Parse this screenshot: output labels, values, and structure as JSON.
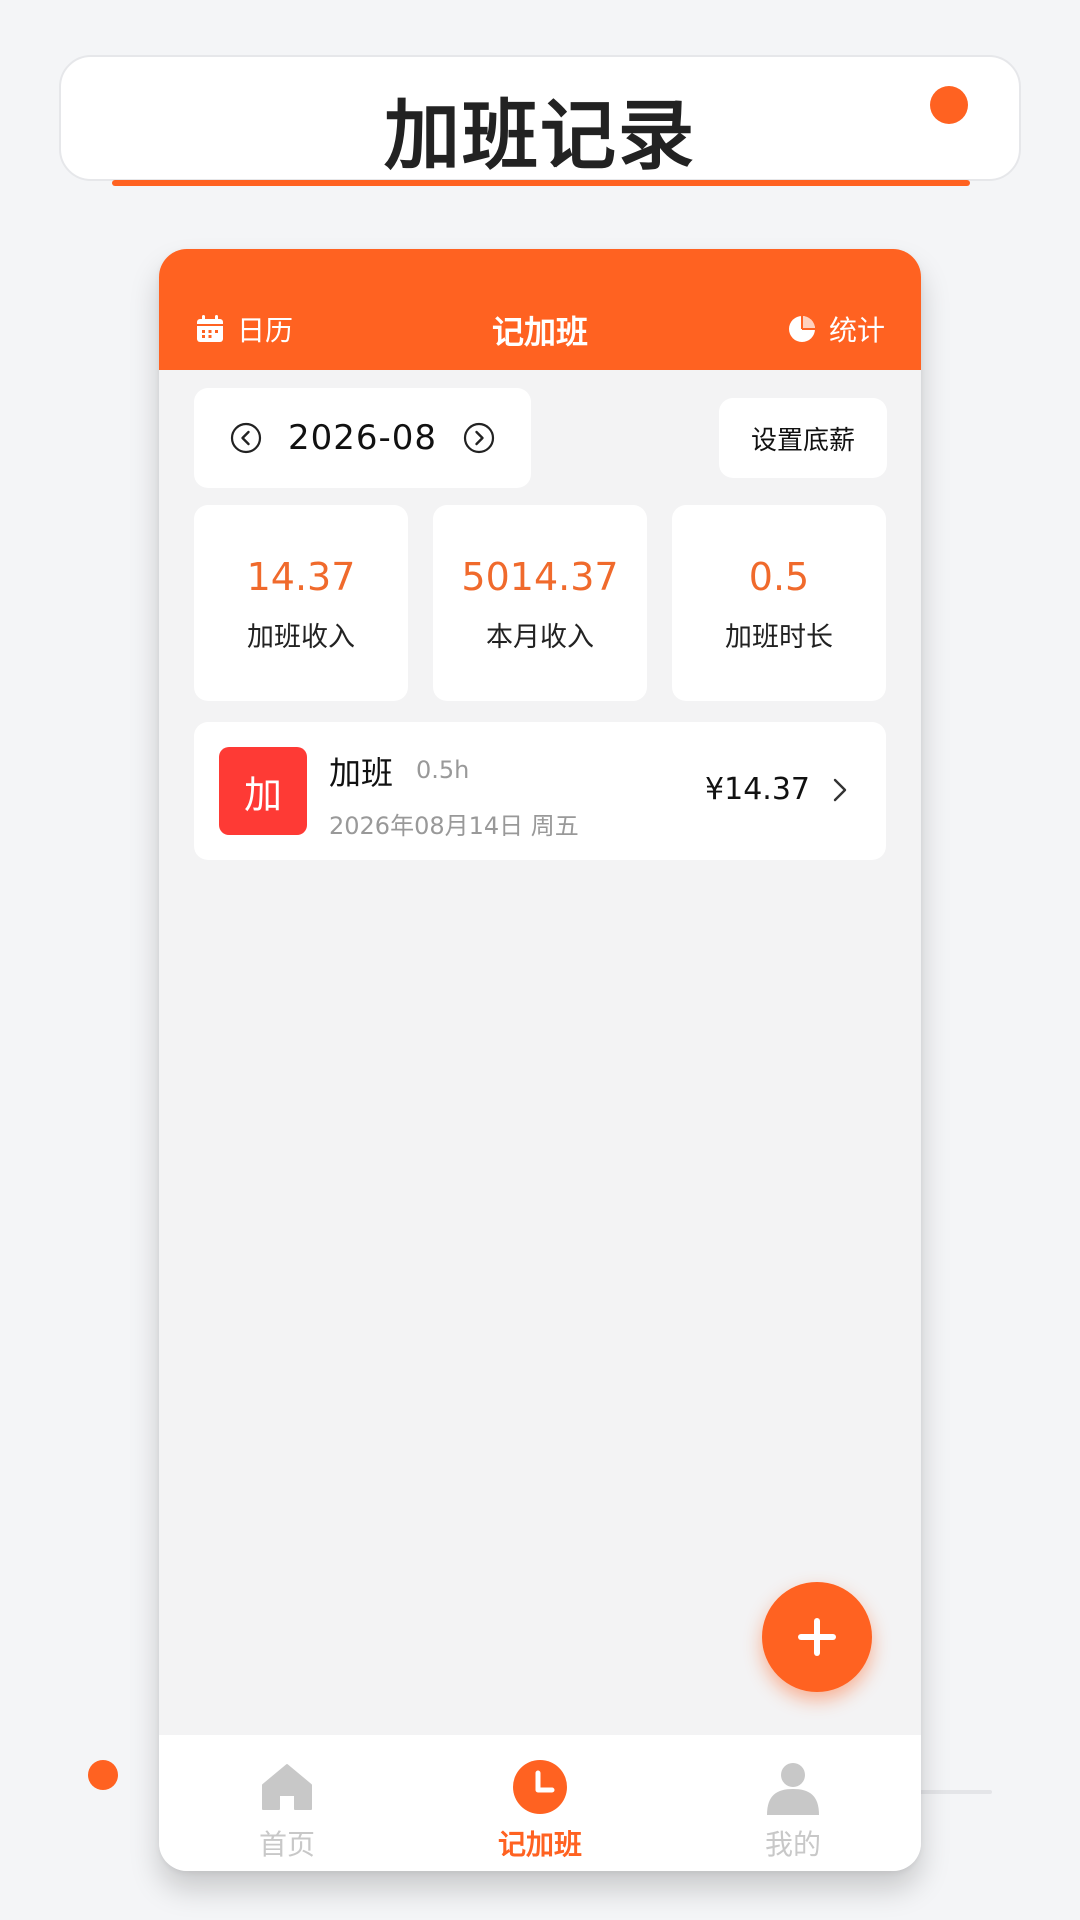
{
  "page": {
    "title": "加班记录"
  },
  "colors": {
    "accent": "#ff6221",
    "value_text": "#f06a2c",
    "badge": "#fe3a35",
    "inactive_tab": "#c8c8c8"
  },
  "header": {
    "left_label": "日历",
    "left_icon": "calendar-icon",
    "title": "记加班",
    "right_label": "统计",
    "right_icon": "pie-chart-icon"
  },
  "month_selector": {
    "value": "2026-08",
    "prev_icon": "chevron-left-circle-icon",
    "next_icon": "chevron-right-circle-icon"
  },
  "salary_button": {
    "label": "设置底薪"
  },
  "stats": [
    {
      "value": "14.37",
      "label": "加班收入"
    },
    {
      "value": "5014.37",
      "label": "本月收入"
    },
    {
      "value": "0.5",
      "label": "加班时长"
    }
  ],
  "records": [
    {
      "badge": "加",
      "title": "加班",
      "hours": "0.5h",
      "date": "2026年08月14日  周五",
      "amount": "¥14.37"
    }
  ],
  "fab": {
    "icon": "plus-icon"
  },
  "tabbar": {
    "items": [
      {
        "label": "首页",
        "icon": "home-icon",
        "active": false
      },
      {
        "label": "记加班",
        "icon": "clock-icon",
        "active": true
      },
      {
        "label": "我的",
        "icon": "user-icon",
        "active": false
      }
    ]
  }
}
